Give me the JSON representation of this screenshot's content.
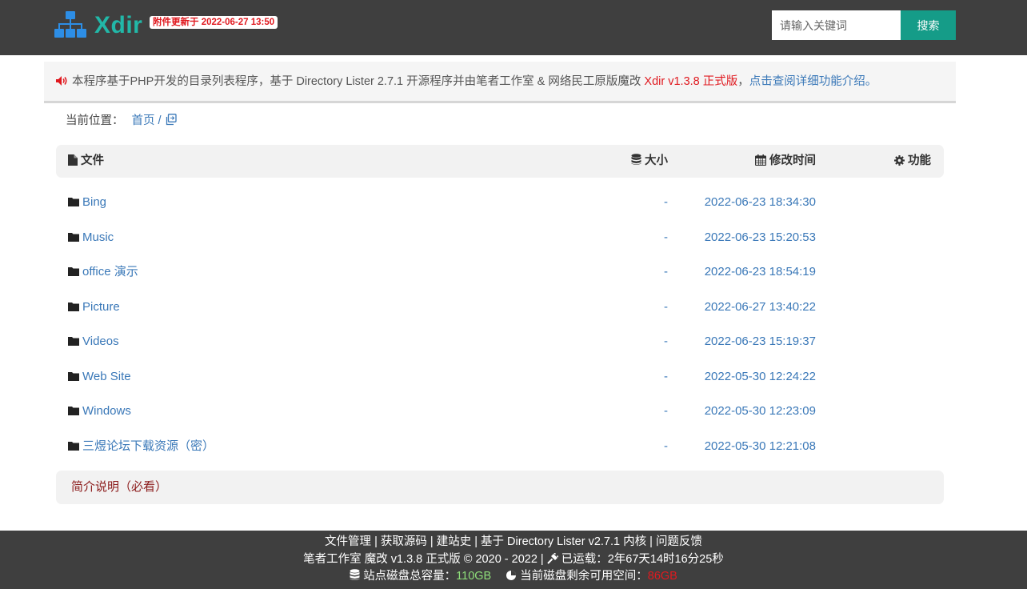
{
  "header": {
    "logo_text": "Xdir",
    "update_badge": "附件更新于 2022-06-27 13:50",
    "search_placeholder": "请输入关键词",
    "search_button": "搜索"
  },
  "notice": {
    "text": "本程序基于PHP开发的目录列表程序，基于 Directory Lister 2.7.1 开源程序并由笔者工作室 & 网络民工原版魔改 ",
    "version": "Xdir v1.3.8 正式版",
    "comma": "，",
    "link": "点击查阅详细功能介绍。"
  },
  "breadcrumb": {
    "label": "当前位置：",
    "home": "首页",
    "sep": "/"
  },
  "table": {
    "headers": {
      "file": "文件",
      "size": "大小",
      "modified": "修改时间",
      "actions": "功能"
    },
    "rows": [
      {
        "name": "Bing",
        "size": "-",
        "time": "2022-06-23 18:34:30"
      },
      {
        "name": "Music",
        "size": "-",
        "time": "2022-06-23 15:20:53"
      },
      {
        "name": "office 演示",
        "size": "-",
        "time": "2022-06-23 18:54:19"
      },
      {
        "name": "Picture",
        "size": "-",
        "time": "2022-06-27 13:40:22"
      },
      {
        "name": "Videos",
        "size": "-",
        "time": "2022-06-23 15:19:37"
      },
      {
        "name": "Web Site",
        "size": "-",
        "time": "2022-05-30 12:24:22"
      },
      {
        "name": "Windows",
        "size": "-",
        "time": "2022-05-30 12:23:09"
      },
      {
        "name": "三煜论坛下载资源（密）",
        "size": "-",
        "time": "2022-05-30 12:21:08"
      }
    ]
  },
  "intro": {
    "label": "简介说明（必看）"
  },
  "footer": {
    "links": [
      "文件管理",
      "获取源码",
      "建站史",
      "基于 Directory Lister v2.7.1 内核",
      "问题反馈"
    ],
    "link_sep": " | ",
    "copyright": "笔者工作室 魔改 v1.3.8 正式版 © 2020 - 2022 | ",
    "uptime_label": "已运载：",
    "uptime_value": "2年67天14时16分25秒",
    "disk_total_label": "站点磁盘总容量：",
    "disk_total_value": "110GB",
    "disk_free_label": "当前磁盘剩余可用空间：",
    "disk_free_value": "86GB"
  },
  "colors": {
    "header_bg": "#3f3f3f",
    "accent_teal": "#22b8a8",
    "search_button": "#159c88",
    "link_blue": "#3a78b8",
    "red": "#e0191f",
    "green": "#8fdf7a"
  },
  "icons": {
    "logo": "sitemap-icon",
    "notice": "volume-icon",
    "breadcrumb_copy": "copy-icon",
    "file_header": "file-icon",
    "size_header": "database-icon",
    "time_header": "calendar-icon",
    "func_header": "gear-icon",
    "row": "folder-icon",
    "uptime": "plug-icon",
    "disk_total": "database-icon",
    "disk_free": "pie-chart-icon"
  }
}
